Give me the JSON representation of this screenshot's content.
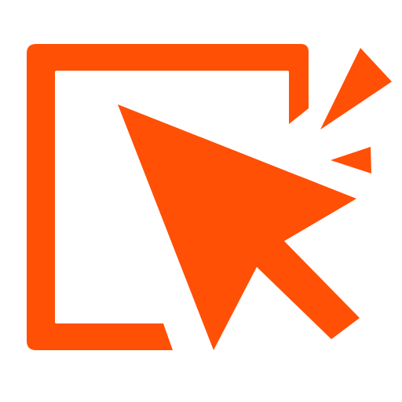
{
  "icon": {
    "name": "click-cursor-icon",
    "color": "#ff5006",
    "background": "#ffffff",
    "parts": [
      "window-frame",
      "arrow-cursor",
      "click-spark-large",
      "click-spark-small"
    ]
  }
}
